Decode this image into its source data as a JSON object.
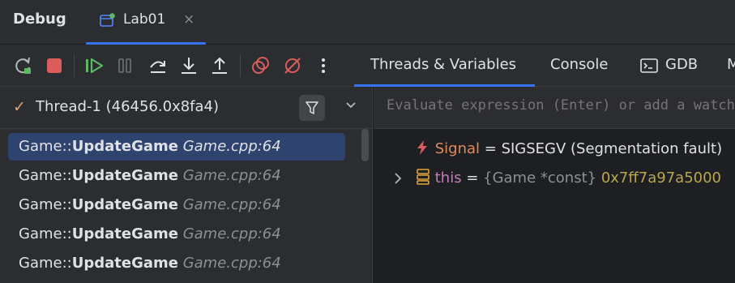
{
  "header": {
    "title": "Debug",
    "tab": {
      "label": "Lab01",
      "close": "×",
      "status_color": "#5fb865"
    }
  },
  "toolbar": {
    "buttons": [
      {
        "name": "rerun-icon"
      },
      {
        "name": "stop-icon"
      },
      {
        "name": "resume-icon"
      },
      {
        "name": "pause-icon"
      },
      {
        "name": "step-over-icon"
      },
      {
        "name": "step-into-icon"
      },
      {
        "name": "step-out-icon"
      },
      {
        "name": "view-breakpoints-icon"
      },
      {
        "name": "mute-breakpoints-icon"
      },
      {
        "name": "more-icon"
      }
    ],
    "tabs": [
      {
        "label": "Threads & Variables",
        "selected": true
      },
      {
        "label": "Console"
      },
      {
        "label": "GDB"
      },
      {
        "label": "M"
      }
    ]
  },
  "thread": {
    "label": "Thread-1 (46456.0x8fa4)"
  },
  "frames": [
    {
      "ns": "Game::",
      "fn": "UpdateGame",
      "loc": "Game.cpp:64",
      "selected": true
    },
    {
      "ns": "Game::",
      "fn": "UpdateGame",
      "loc": "Game.cpp:64"
    },
    {
      "ns": "Game::",
      "fn": "UpdateGame",
      "loc": "Game.cpp:64"
    },
    {
      "ns": "Game::",
      "fn": "UpdateGame",
      "loc": "Game.cpp:64"
    },
    {
      "ns": "Game::",
      "fn": "UpdateGame",
      "loc": "Game.cpp:64"
    }
  ],
  "evaluate": {
    "placeholder": "Evaluate expression (Enter) or add a watch (Ctrl+Shift+Enter)"
  },
  "variables": [
    {
      "name": "Signal",
      "eq": " = ",
      "value": "SIGSEGV (Segmentation fault)"
    },
    {
      "name": "this",
      "eq": " = ",
      "type": "{Game *const}",
      "value": "0x7ff7a97a5000"
    }
  ],
  "colors": {
    "accent": "#3574f0",
    "selection": "#2e436e",
    "background": "#1e1f22",
    "panel": "#2b2d30"
  }
}
